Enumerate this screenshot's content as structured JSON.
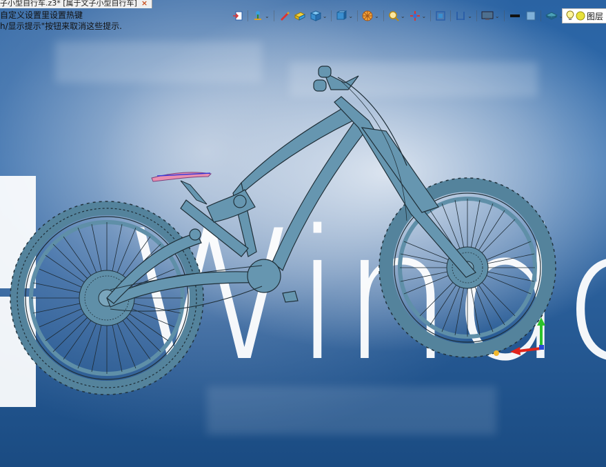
{
  "window": {
    "doc_tab_title": "子小型自行车.z3* [属于文子小型自行车]",
    "close_glyph": "×"
  },
  "hints": {
    "line1": "自定义设置里设置热键",
    "line2": "h/显示提示\"按钮来取消这些提示."
  },
  "toolbar": {
    "items": [
      {
        "icon": "exit-view-icon",
        "has_dropdown": false
      },
      {
        "icon": "csys-pin-icon",
        "has_dropdown": true
      },
      {
        "icon": "pen-sketch-icon",
        "has_dropdown": false
      },
      {
        "icon": "yellow-block-icon",
        "has_dropdown": false
      },
      {
        "icon": "blue-cube-icon",
        "has_dropdown": true
      },
      {
        "icon": "view-cube-icon",
        "has_dropdown": true
      },
      {
        "icon": "render-wheel-icon",
        "has_dropdown": true
      },
      {
        "icon": "zoom-icon",
        "has_dropdown": true
      },
      {
        "icon": "red-axis-icon",
        "has_dropdown": true
      },
      {
        "icon": "fit-view-icon",
        "has_dropdown": false
      },
      {
        "icon": "section-view-icon",
        "has_dropdown": true
      },
      {
        "icon": "monitor-icon",
        "has_dropdown": true
      },
      {
        "icon": "black-bar-icon",
        "has_dropdown": false
      },
      {
        "icon": "blue-square-icon",
        "has_dropdown": false
      },
      {
        "icon": "layers-stack-icon",
        "has_dropdown": true
      }
    ]
  },
  "layer_panel": {
    "label": "图层",
    "bulb_icon": "lightbulb-icon",
    "status_icon": "layer-status-icon"
  },
  "background": {
    "wallpaper_text": "Windo",
    "colors": {
      "wallpaper_blue": "#1b4d83",
      "model_color": "#5f8fa8",
      "edge_color": "#1f2f38",
      "saddle_color": "#e98fb0"
    }
  },
  "triad": {
    "x_color": "#e0241b",
    "y_color": "#2cc32c",
    "z_color": "#2a4bd6"
  }
}
